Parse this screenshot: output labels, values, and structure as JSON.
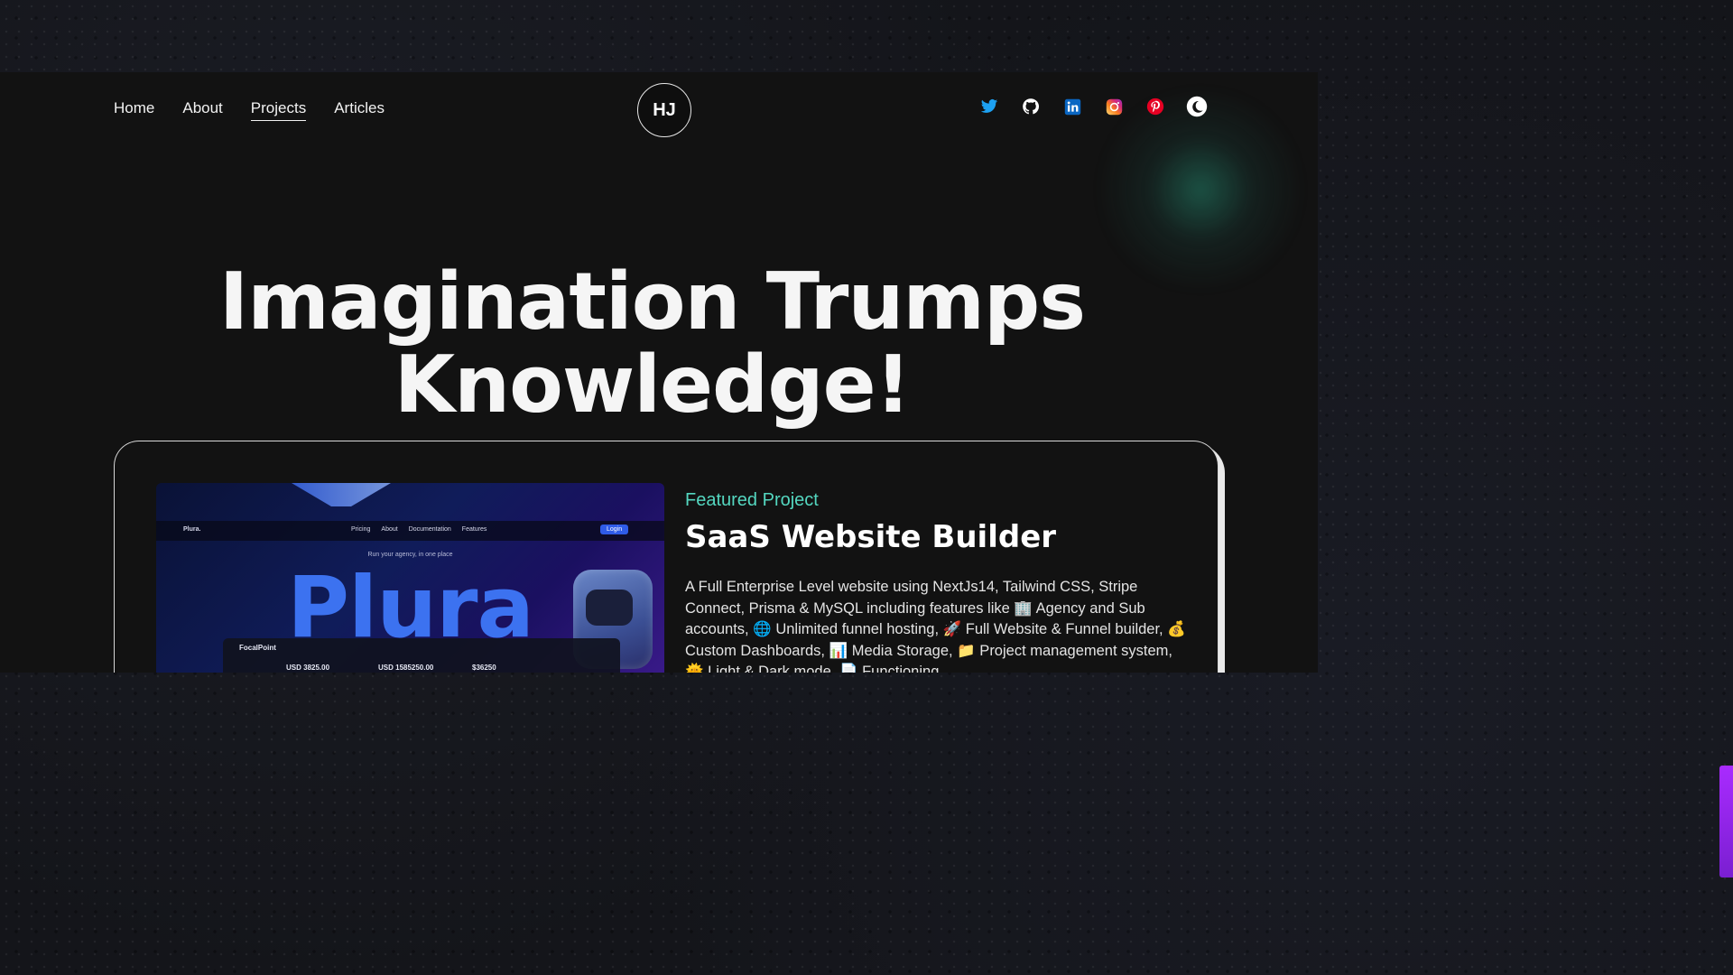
{
  "nav": {
    "items": [
      {
        "label": "Home"
      },
      {
        "label": "About"
      },
      {
        "label": "Projects"
      },
      {
        "label": "Articles"
      }
    ],
    "active": "Projects"
  },
  "logo": {
    "initials": "HJ"
  },
  "socials": [
    {
      "icon": "twitter-icon",
      "color": "#1DA1F2"
    },
    {
      "icon": "github-icon",
      "color": "#FFFFFF"
    },
    {
      "icon": "linkedin-icon",
      "color": "#0A66C2"
    },
    {
      "icon": "instagram-icon",
      "color": "#E1306C"
    },
    {
      "icon": "pinterest-icon",
      "color": "#E60023"
    },
    {
      "icon": "theme-toggle-icon",
      "color": "#FFFFFF"
    }
  ],
  "hero": {
    "line1": "Imagination Trumps",
    "line2": "Knowledge!"
  },
  "featured_project": {
    "eyebrow": "Featured Project",
    "title": "SaaS Website Builder",
    "description": "A Full Enterprise Level website using NextJs14, Tailwind CSS, Stripe Connect, Prisma & MySQL including features like 🏢 Agency and Sub accounts, 🌐 Unlimited funnel hosting, 🚀 Full Website & Funnel builder, 💰 Custom Dashboards, 📊 Media Storage, 📁 Project management system, 🌞 Light & Dark mode, 📄 Functioning",
    "screenshot": {
      "brand": "Plura.",
      "links": [
        "Pricing",
        "About",
        "Documentation",
        "Features"
      ],
      "login": "Login",
      "tagline": "Run your agency, in one place",
      "wordmark": "Plura",
      "panel_title": "FocalPoint",
      "values": [
        "USD 3825.00",
        "USD 1585250.00",
        "$36250"
      ]
    }
  },
  "colors": {
    "accent": "#54D7C0",
    "background": "#121212",
    "text": "#F5F5F5"
  }
}
